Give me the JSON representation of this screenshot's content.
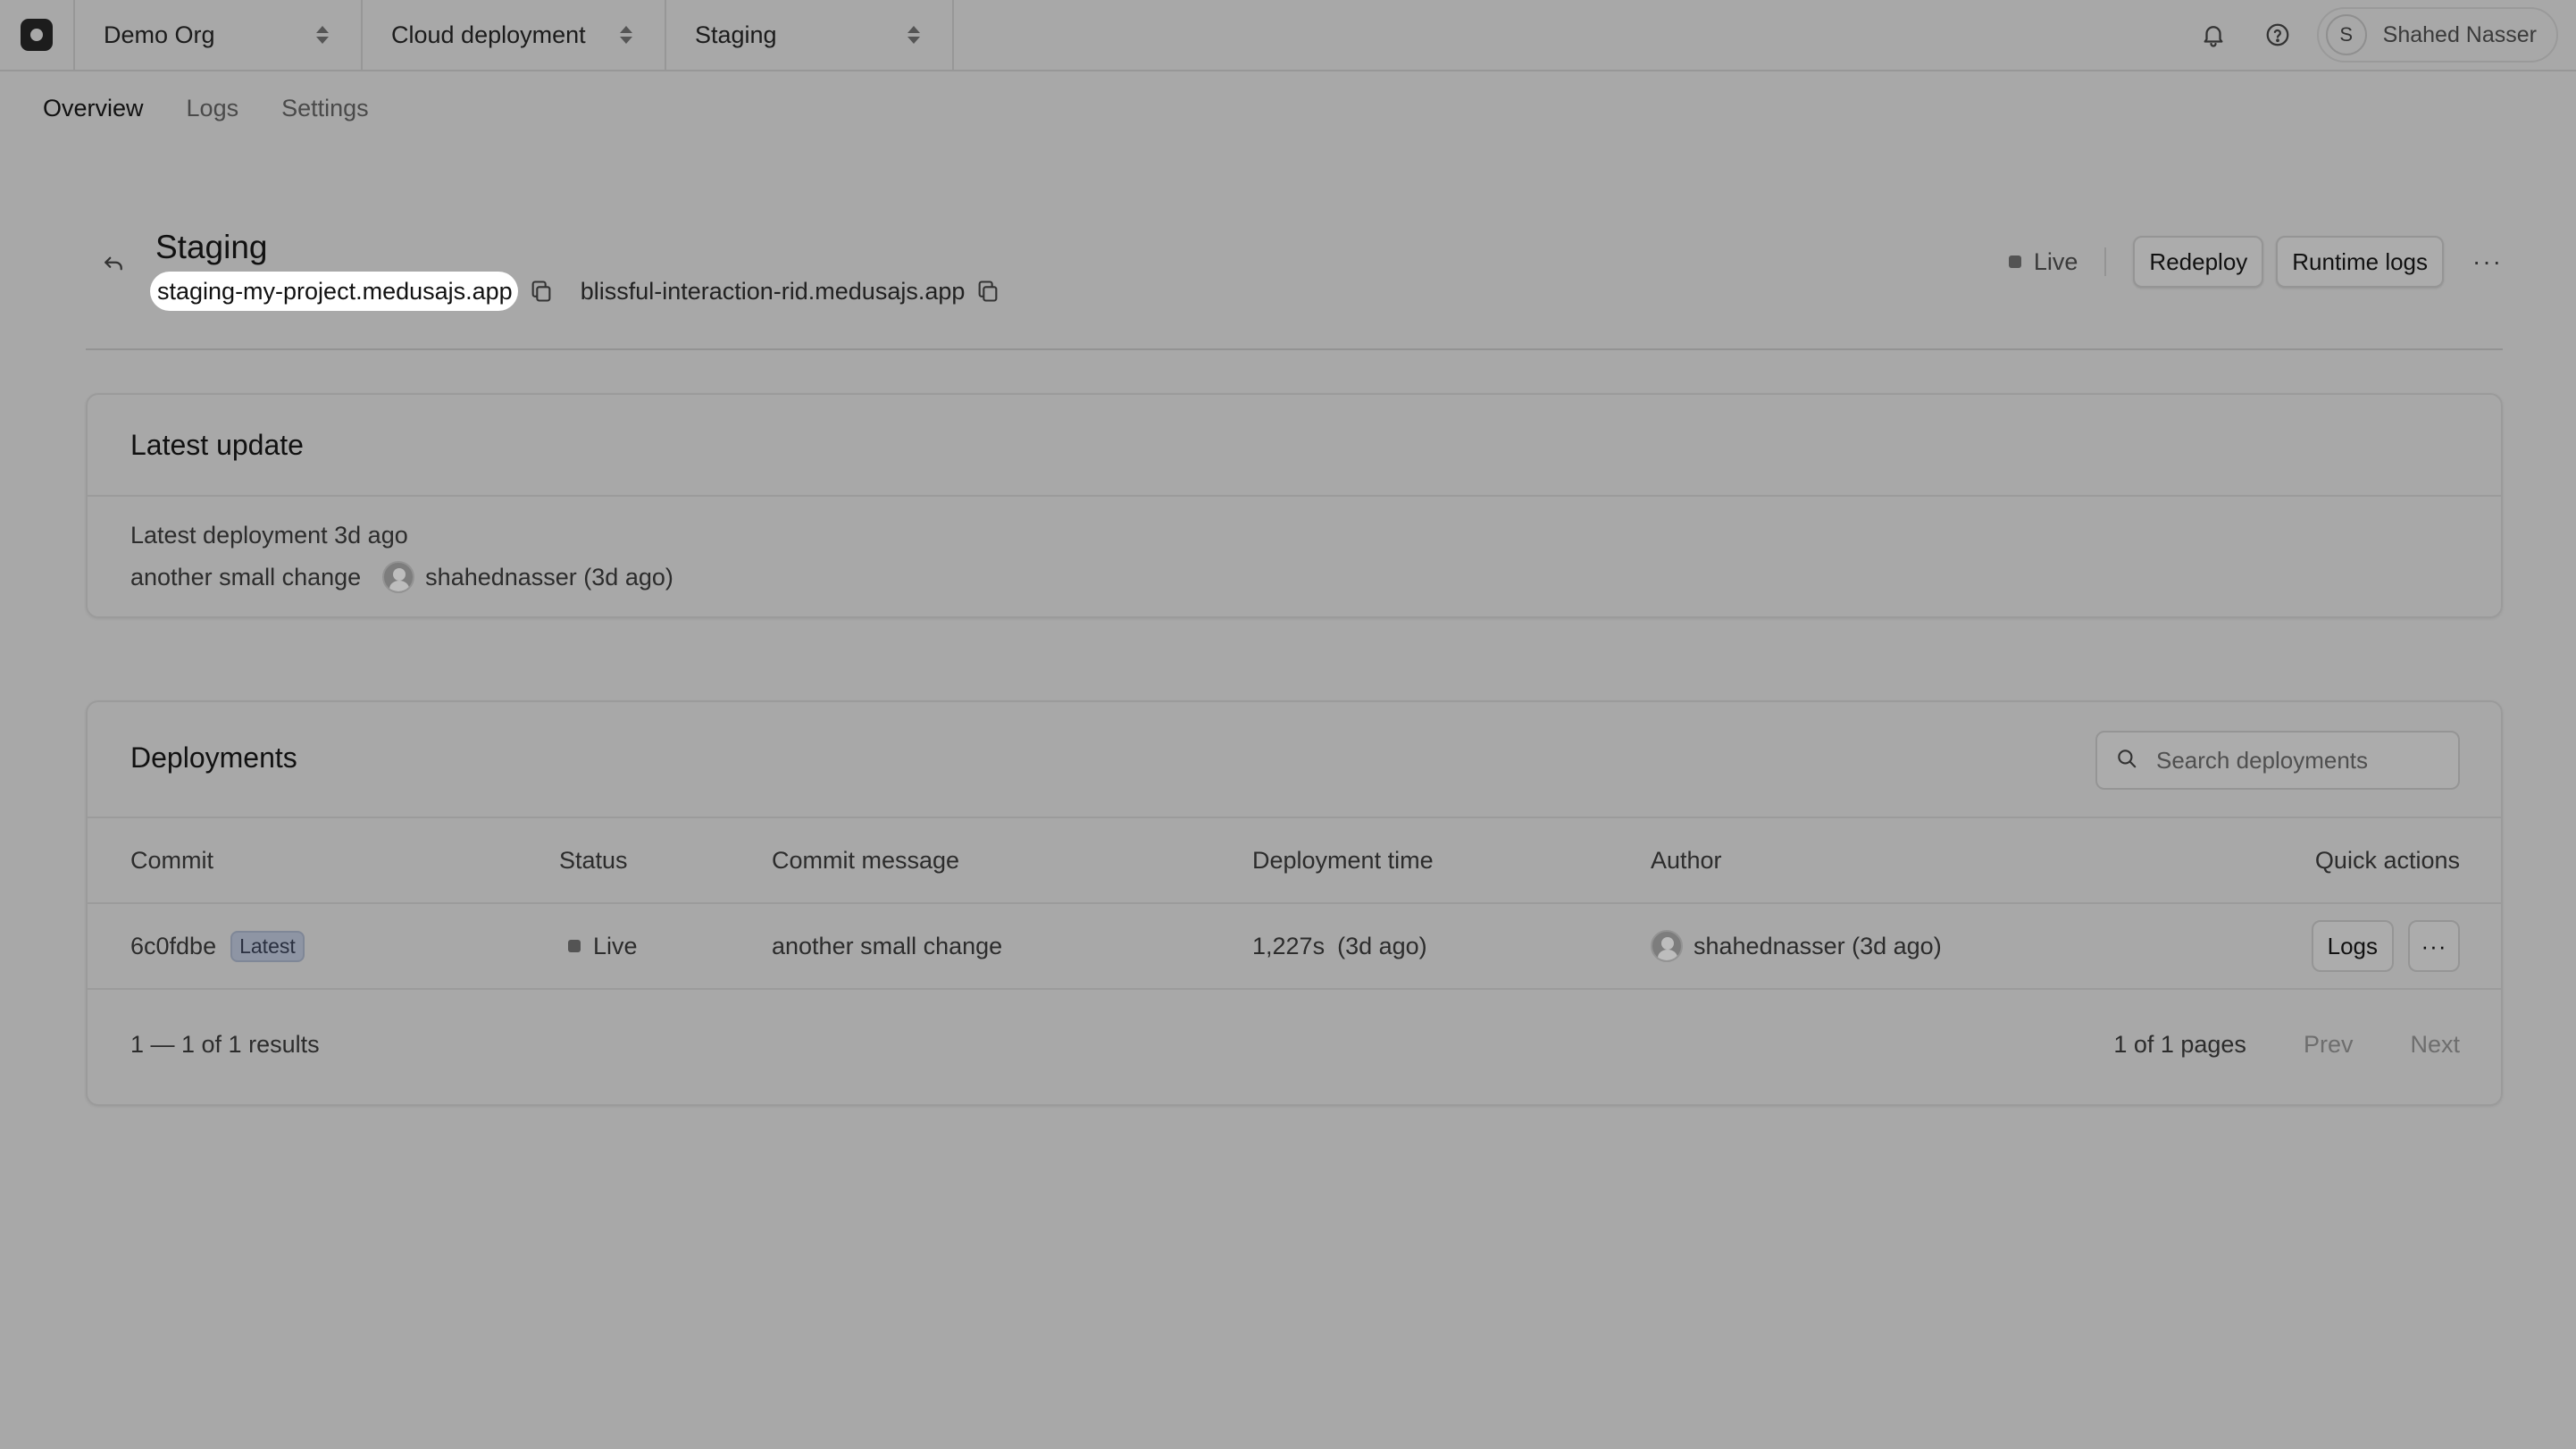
{
  "topbar": {
    "org": "Demo Org",
    "project": "Cloud deployment",
    "environment": "Staging",
    "user": {
      "initial": "S",
      "name": "Shahed Nasser"
    },
    "icons": [
      "bell-icon",
      "help-icon"
    ]
  },
  "tabs": [
    {
      "label": "Overview",
      "active": true
    },
    {
      "label": "Logs",
      "active": false
    },
    {
      "label": "Settings",
      "active": false
    }
  ],
  "header": {
    "title": "Staging",
    "primary_url": "staging-my-project.medusajs.app",
    "secondary_url": "blissful-interaction-rid.medusajs.app",
    "status": "Live",
    "redeploy_label": "Redeploy",
    "runtime_logs_label": "Runtime logs",
    "more_label": "···"
  },
  "latest_update": {
    "title": "Latest update",
    "deployment_text": "Latest deployment 3d ago",
    "commit_message": "another small change",
    "author": "shahednasser (3d ago)"
  },
  "deployments": {
    "title": "Deployments",
    "search_placeholder": "Search deployments",
    "columns": {
      "commit": "Commit",
      "status": "Status",
      "message": "Commit message",
      "time": "Deployment time",
      "author": "Author",
      "quick": "Quick actions"
    },
    "rows": [
      {
        "commit": "6c0fdbe",
        "badge": "Latest",
        "status": "Live",
        "message": "another small change",
        "duration": "1,227s",
        "ago": "(3d ago)",
        "author": "shahednasser (3d ago)",
        "logs_label": "Logs",
        "more_label": "···"
      }
    ],
    "results": "1 — 1 of 1 results",
    "pages": "1 of 1 pages",
    "prev": "Prev",
    "next": "Next"
  },
  "colors": {
    "overlay": "#a8a8a8",
    "highlight": "#ffffff",
    "badge_bg": "#8e95a4"
  }
}
